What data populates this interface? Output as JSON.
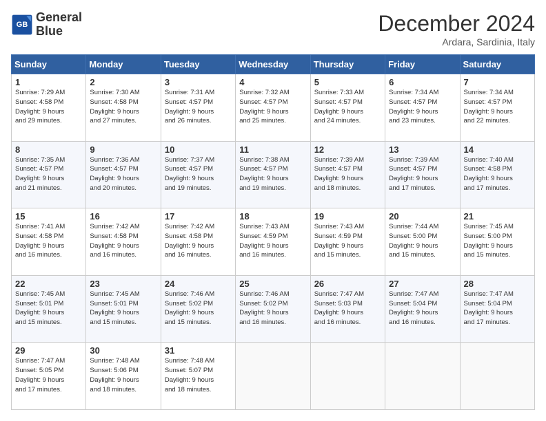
{
  "header": {
    "logo_line1": "General",
    "logo_line2": "Blue",
    "month_title": "December 2024",
    "subtitle": "Ardara, Sardinia, Italy"
  },
  "weekdays": [
    "Sunday",
    "Monday",
    "Tuesday",
    "Wednesday",
    "Thursday",
    "Friday",
    "Saturday"
  ],
  "weeks": [
    [
      {
        "day": "1",
        "info": "Sunrise: 7:29 AM\nSunset: 4:58 PM\nDaylight: 9 hours\nand 29 minutes."
      },
      {
        "day": "2",
        "info": "Sunrise: 7:30 AM\nSunset: 4:58 PM\nDaylight: 9 hours\nand 27 minutes."
      },
      {
        "day": "3",
        "info": "Sunrise: 7:31 AM\nSunset: 4:57 PM\nDaylight: 9 hours\nand 26 minutes."
      },
      {
        "day": "4",
        "info": "Sunrise: 7:32 AM\nSunset: 4:57 PM\nDaylight: 9 hours\nand 25 minutes."
      },
      {
        "day": "5",
        "info": "Sunrise: 7:33 AM\nSunset: 4:57 PM\nDaylight: 9 hours\nand 24 minutes."
      },
      {
        "day": "6",
        "info": "Sunrise: 7:34 AM\nSunset: 4:57 PM\nDaylight: 9 hours\nand 23 minutes."
      },
      {
        "day": "7",
        "info": "Sunrise: 7:34 AM\nSunset: 4:57 PM\nDaylight: 9 hours\nand 22 minutes."
      }
    ],
    [
      {
        "day": "8",
        "info": "Sunrise: 7:35 AM\nSunset: 4:57 PM\nDaylight: 9 hours\nand 21 minutes."
      },
      {
        "day": "9",
        "info": "Sunrise: 7:36 AM\nSunset: 4:57 PM\nDaylight: 9 hours\nand 20 minutes."
      },
      {
        "day": "10",
        "info": "Sunrise: 7:37 AM\nSunset: 4:57 PM\nDaylight: 9 hours\nand 19 minutes."
      },
      {
        "day": "11",
        "info": "Sunrise: 7:38 AM\nSunset: 4:57 PM\nDaylight: 9 hours\nand 19 minutes."
      },
      {
        "day": "12",
        "info": "Sunrise: 7:39 AM\nSunset: 4:57 PM\nDaylight: 9 hours\nand 18 minutes."
      },
      {
        "day": "13",
        "info": "Sunrise: 7:39 AM\nSunset: 4:57 PM\nDaylight: 9 hours\nand 17 minutes."
      },
      {
        "day": "14",
        "info": "Sunrise: 7:40 AM\nSunset: 4:58 PM\nDaylight: 9 hours\nand 17 minutes."
      }
    ],
    [
      {
        "day": "15",
        "info": "Sunrise: 7:41 AM\nSunset: 4:58 PM\nDaylight: 9 hours\nand 16 minutes."
      },
      {
        "day": "16",
        "info": "Sunrise: 7:42 AM\nSunset: 4:58 PM\nDaylight: 9 hours\nand 16 minutes."
      },
      {
        "day": "17",
        "info": "Sunrise: 7:42 AM\nSunset: 4:58 PM\nDaylight: 9 hours\nand 16 minutes."
      },
      {
        "day": "18",
        "info": "Sunrise: 7:43 AM\nSunset: 4:59 PM\nDaylight: 9 hours\nand 16 minutes."
      },
      {
        "day": "19",
        "info": "Sunrise: 7:43 AM\nSunset: 4:59 PM\nDaylight: 9 hours\nand 15 minutes."
      },
      {
        "day": "20",
        "info": "Sunrise: 7:44 AM\nSunset: 5:00 PM\nDaylight: 9 hours\nand 15 minutes."
      },
      {
        "day": "21",
        "info": "Sunrise: 7:45 AM\nSunset: 5:00 PM\nDaylight: 9 hours\nand 15 minutes."
      }
    ],
    [
      {
        "day": "22",
        "info": "Sunrise: 7:45 AM\nSunset: 5:01 PM\nDaylight: 9 hours\nand 15 minutes."
      },
      {
        "day": "23",
        "info": "Sunrise: 7:45 AM\nSunset: 5:01 PM\nDaylight: 9 hours\nand 15 minutes."
      },
      {
        "day": "24",
        "info": "Sunrise: 7:46 AM\nSunset: 5:02 PM\nDaylight: 9 hours\nand 15 minutes."
      },
      {
        "day": "25",
        "info": "Sunrise: 7:46 AM\nSunset: 5:02 PM\nDaylight: 9 hours\nand 16 minutes."
      },
      {
        "day": "26",
        "info": "Sunrise: 7:47 AM\nSunset: 5:03 PM\nDaylight: 9 hours\nand 16 minutes."
      },
      {
        "day": "27",
        "info": "Sunrise: 7:47 AM\nSunset: 5:04 PM\nDaylight: 9 hours\nand 16 minutes."
      },
      {
        "day": "28",
        "info": "Sunrise: 7:47 AM\nSunset: 5:04 PM\nDaylight: 9 hours\nand 17 minutes."
      }
    ],
    [
      {
        "day": "29",
        "info": "Sunrise: 7:47 AM\nSunset: 5:05 PM\nDaylight: 9 hours\nand 17 minutes."
      },
      {
        "day": "30",
        "info": "Sunrise: 7:48 AM\nSunset: 5:06 PM\nDaylight: 9 hours\nand 18 minutes."
      },
      {
        "day": "31",
        "info": "Sunrise: 7:48 AM\nSunset: 5:07 PM\nDaylight: 9 hours\nand 18 minutes."
      },
      {
        "day": "",
        "info": ""
      },
      {
        "day": "",
        "info": ""
      },
      {
        "day": "",
        "info": ""
      },
      {
        "day": "",
        "info": ""
      }
    ]
  ]
}
